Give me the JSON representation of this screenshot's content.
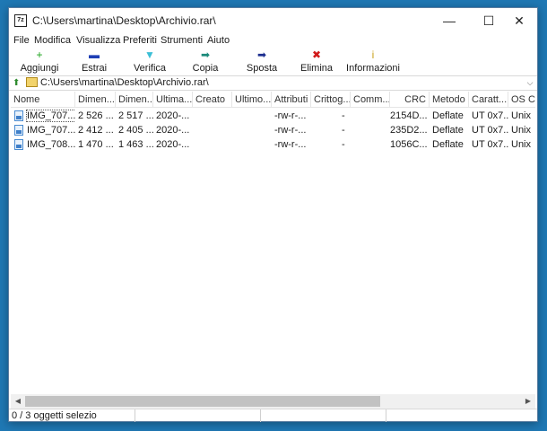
{
  "window": {
    "title": "C:\\Users\\martina\\Desktop\\Archivio.rar\\",
    "app_icon_text": "7z",
    "controls": {
      "minimize": "—",
      "maximize": "☐",
      "close": "✕"
    }
  },
  "menu": [
    "File",
    "Modifica",
    "Visualizza",
    "Preferiti",
    "Strumenti",
    "Aiuto"
  ],
  "toolbar": [
    {
      "label": "Aggiungi",
      "icon": "plus-icon",
      "glyph": "+",
      "color": "#1aa31a"
    },
    {
      "label": "Estrai",
      "icon": "minus-icon",
      "glyph": "▬",
      "color": "#1f3fb5"
    },
    {
      "label": "Verifica",
      "icon": "check-icon",
      "glyph": "▼",
      "color": "#3cbfd6"
    },
    {
      "label": "Copia",
      "icon": "copy-arrow-icon",
      "glyph": "➡",
      "color": "#1b8a7a"
    },
    {
      "label": "Sposta",
      "icon": "move-arrow-icon",
      "glyph": "➡",
      "color": "#1c2e8f"
    },
    {
      "label": "Elimina",
      "icon": "delete-x-icon",
      "glyph": "✖",
      "color": "#d11a1a"
    },
    {
      "label": "Informazioni",
      "icon": "info-icon",
      "glyph": "i",
      "color": "#c9a11a"
    }
  ],
  "address": {
    "path": "C:\\Users\\martina\\Desktop\\Archivio.rar\\",
    "up_glyph": "⬆",
    "dropdown_glyph": "⌵"
  },
  "columns": [
    "Nome",
    "Dimen...",
    "Dimen...",
    "Ultima...",
    "Creato",
    "Ultimo...",
    "Attributi",
    "Crittog...",
    "Comm...",
    "CRC",
    "Metodo",
    "Caratt...",
    "OS Co"
  ],
  "rows": [
    [
      "IMG_707...",
      "2 526 ...",
      "2 517 ...",
      "2020-...",
      "",
      "",
      "-rw-r-...",
      "-",
      "",
      "2154D...",
      "Deflate",
      "UT 0x7...",
      "Unix"
    ],
    [
      "IMG_707...",
      "2 412 ...",
      "2 405 ...",
      "2020-...",
      "",
      "",
      "-rw-r-...",
      "-",
      "",
      "235D2...",
      "Deflate",
      "UT 0x7...",
      "Unix"
    ],
    [
      "IMG_708...",
      "1 470 ...",
      "1 463 ...",
      "2020-...",
      "",
      "",
      "-rw-r-...",
      "-",
      "",
      "1056C...",
      "Deflate",
      "UT 0x7...",
      "Unix"
    ]
  ],
  "scrollbar": {
    "left_glyph": "◀",
    "right_glyph": "▶"
  },
  "status": {
    "selection": "0 / 3 oggetti selezio"
  }
}
